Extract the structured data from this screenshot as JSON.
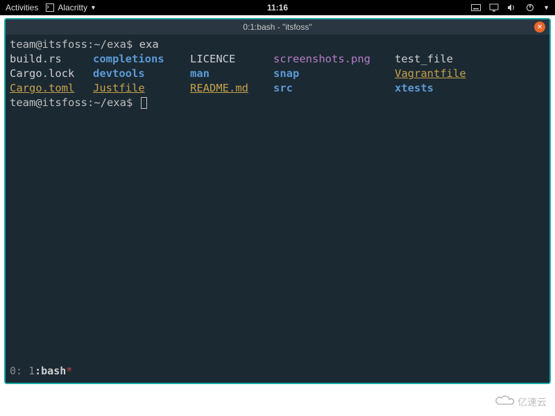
{
  "topbar": {
    "activities": "Activities",
    "app_name": "Alacritty",
    "clock": "11:16"
  },
  "window": {
    "title": "0:1:bash - \"itsfoss\""
  },
  "term": {
    "prompt": "team@itsfoss:~/exa$",
    "command": "exa",
    "listing": [
      [
        {
          "t": "build.rs",
          "c": "white"
        },
        {
          "t": "completions",
          "c": "blue"
        },
        {
          "t": "LICENCE",
          "c": "white"
        },
        {
          "t": "screenshots.png",
          "c": "purple"
        },
        {
          "t": "test_file",
          "c": "white"
        }
      ],
      [
        {
          "t": "Cargo.lock",
          "c": "white"
        },
        {
          "t": "devtools",
          "c": "blue"
        },
        {
          "t": "man",
          "c": "blue"
        },
        {
          "t": "snap",
          "c": "blue"
        },
        {
          "t": "Vagrantfile",
          "c": "yellow"
        }
      ],
      [
        {
          "t": "Cargo.toml",
          "c": "yellow"
        },
        {
          "t": "Justfile",
          "c": "yellow"
        },
        {
          "t": "README.md",
          "c": "yellow"
        },
        {
          "t": "src",
          "c": "blue"
        },
        {
          "t": "xtests",
          "c": "blue"
        }
      ]
    ]
  },
  "status": {
    "left_index": "0:",
    "win_index": "1",
    "colon": ":",
    "name": "bash",
    "flag": "*"
  },
  "watermark": "亿速云"
}
